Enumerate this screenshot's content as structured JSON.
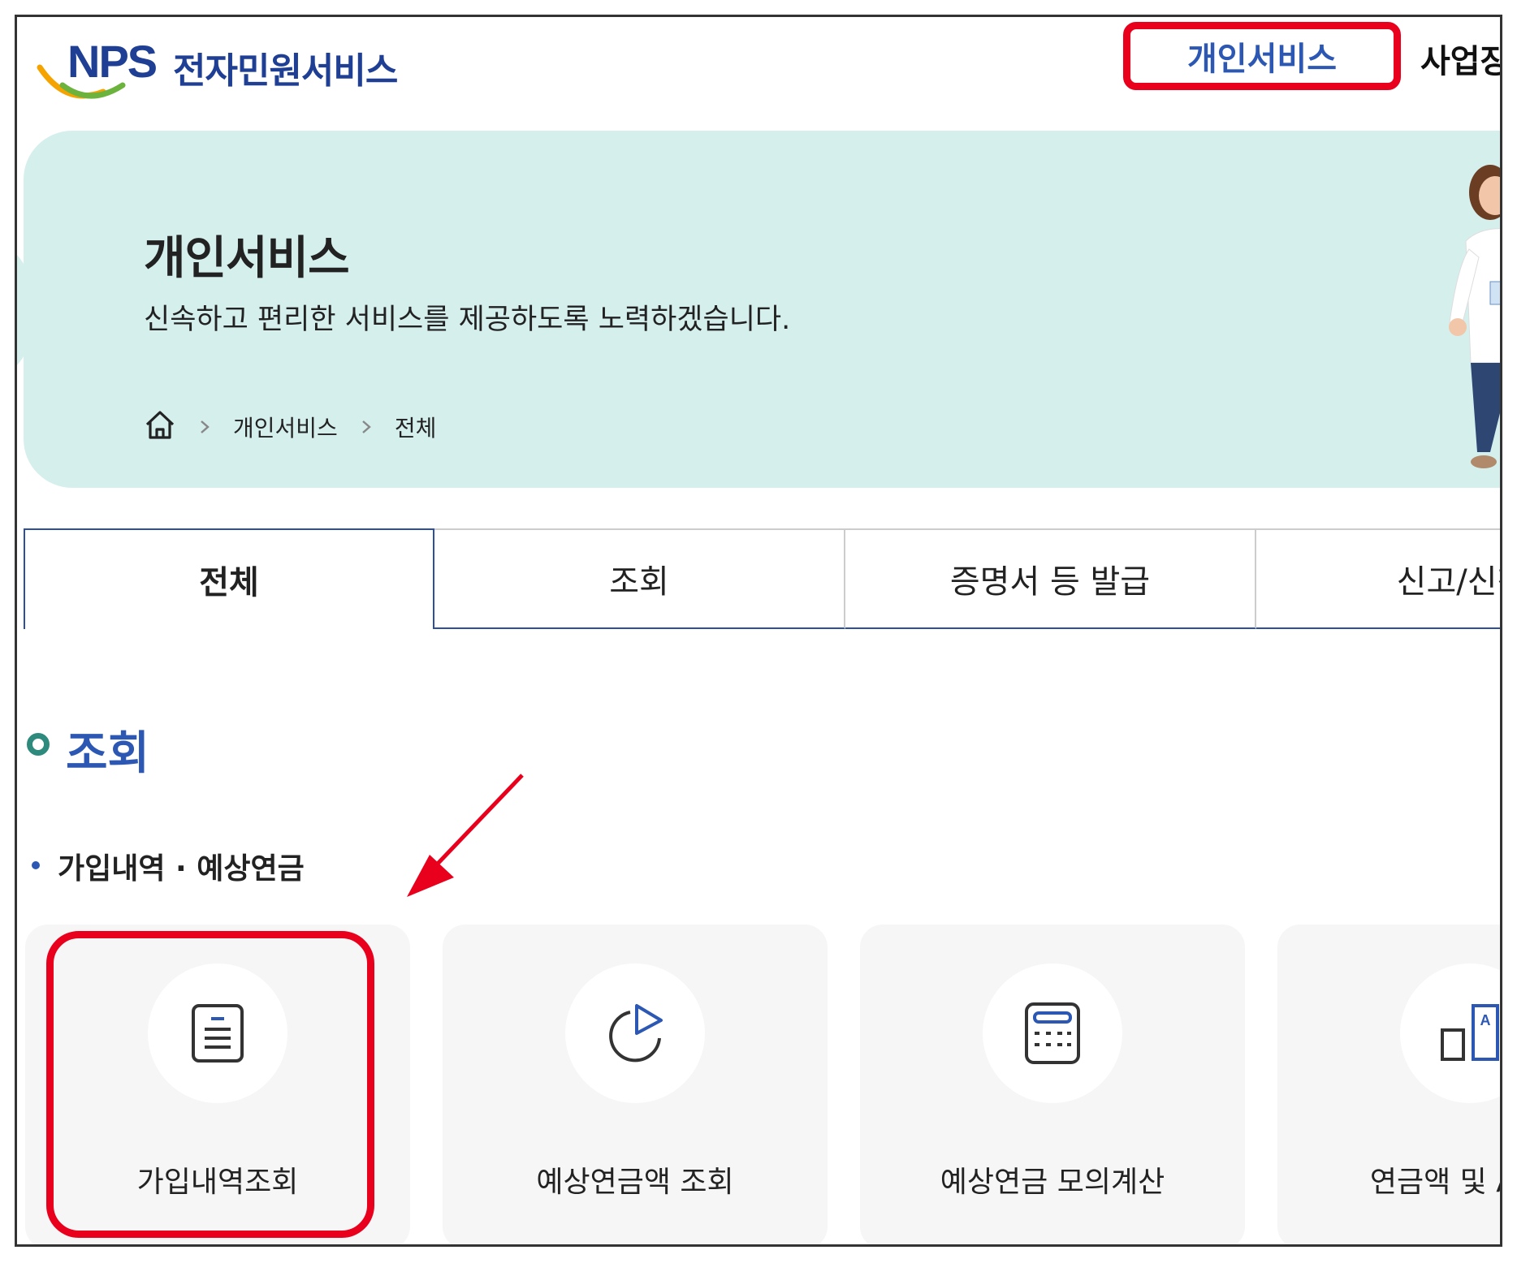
{
  "header": {
    "logo_mark": "NPS",
    "logo_text": "전자민원서비스",
    "nav": [
      {
        "label": "개인서비스"
      },
      {
        "label": "사업장서"
      }
    ]
  },
  "banner": {
    "title": "개인서비스",
    "subtitle": "신속하고 편리한 서비스를 제공하도록 노력하겠습니다.",
    "breadcrumb": [
      "개인서비스",
      "전체"
    ]
  },
  "tabs": [
    {
      "label": "전체",
      "active": true
    },
    {
      "label": "조회"
    },
    {
      "label": "증명서 등 발급"
    },
    {
      "label": "신고/신청"
    }
  ],
  "section": {
    "title": "조회",
    "subsection": "가입내역 · 예상연금",
    "cards": [
      {
        "label": "가입내역조회",
        "icon": "document-icon"
      },
      {
        "label": "예상연금액 조회",
        "icon": "pie-chart-icon"
      },
      {
        "label": "예상연금 모의계산",
        "icon": "calculator-icon"
      },
      {
        "label": "연금액 및 A급여",
        "icon": "compare-icon"
      }
    ]
  },
  "colors": {
    "brand_blue": "#2c58b4",
    "banner_bg": "#d5efed",
    "highlight_red": "#e8001c",
    "accent_green": "#2e8a7c"
  }
}
